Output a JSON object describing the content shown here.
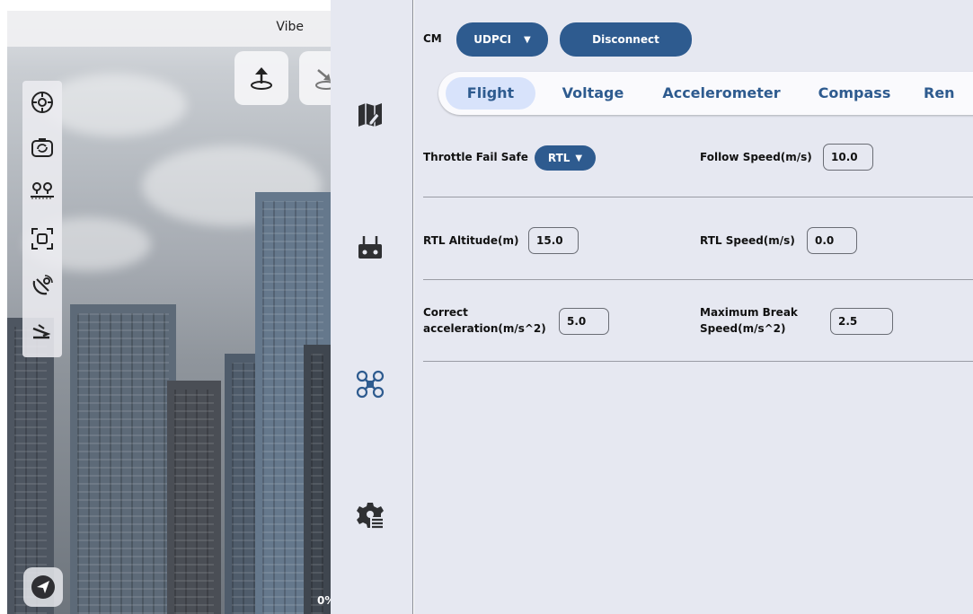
{
  "camera": {
    "title": "Vibe",
    "percent": "0%",
    "tools": [
      "focus-target-icon",
      "camera-switch-icon",
      "waypoint-ruler-icon",
      "crop-frame-icon",
      "satellite-dish-icon",
      "landing-icon"
    ]
  },
  "left_nav": {
    "items": [
      "map-edit-icon",
      "remote-controller-icon",
      "drone-icon",
      "settings-gear-list-icon"
    ]
  },
  "connection": {
    "cm_label": "CM",
    "protocol": "UDPCI",
    "disconnect_label": "Disconnect"
  },
  "tabs": [
    "Flight",
    "Voltage",
    "Accelerometer",
    "Compass",
    "Ren"
  ],
  "active_tab": "Flight",
  "settings": {
    "throttle_fail_safe_label": "Throttle Fail Safe",
    "throttle_fail_safe_value": "RTL",
    "follow_speed_label": "Follow Speed(m/s)",
    "follow_speed_value": "10.0",
    "rtl_altitude_label": "RTL Altitude(m)",
    "rtl_altitude_value": "15.0",
    "rtl_speed_label": "RTL Speed(m/s)",
    "rtl_speed_value": "0.0",
    "correct_accel_label_line1": "Correct",
    "correct_accel_label_line2": "acceleration(m/s^2)",
    "correct_accel_value": "5.0",
    "max_break_label_line1": "Maximum Break",
    "max_break_label_line2": "Speed(m/s^2)",
    "max_break_value": "2.5"
  },
  "colors": {
    "accent": "#2e5b8f",
    "panel_bg": "#e6e8f1",
    "active_tab_bg": "#d8e3fb"
  }
}
